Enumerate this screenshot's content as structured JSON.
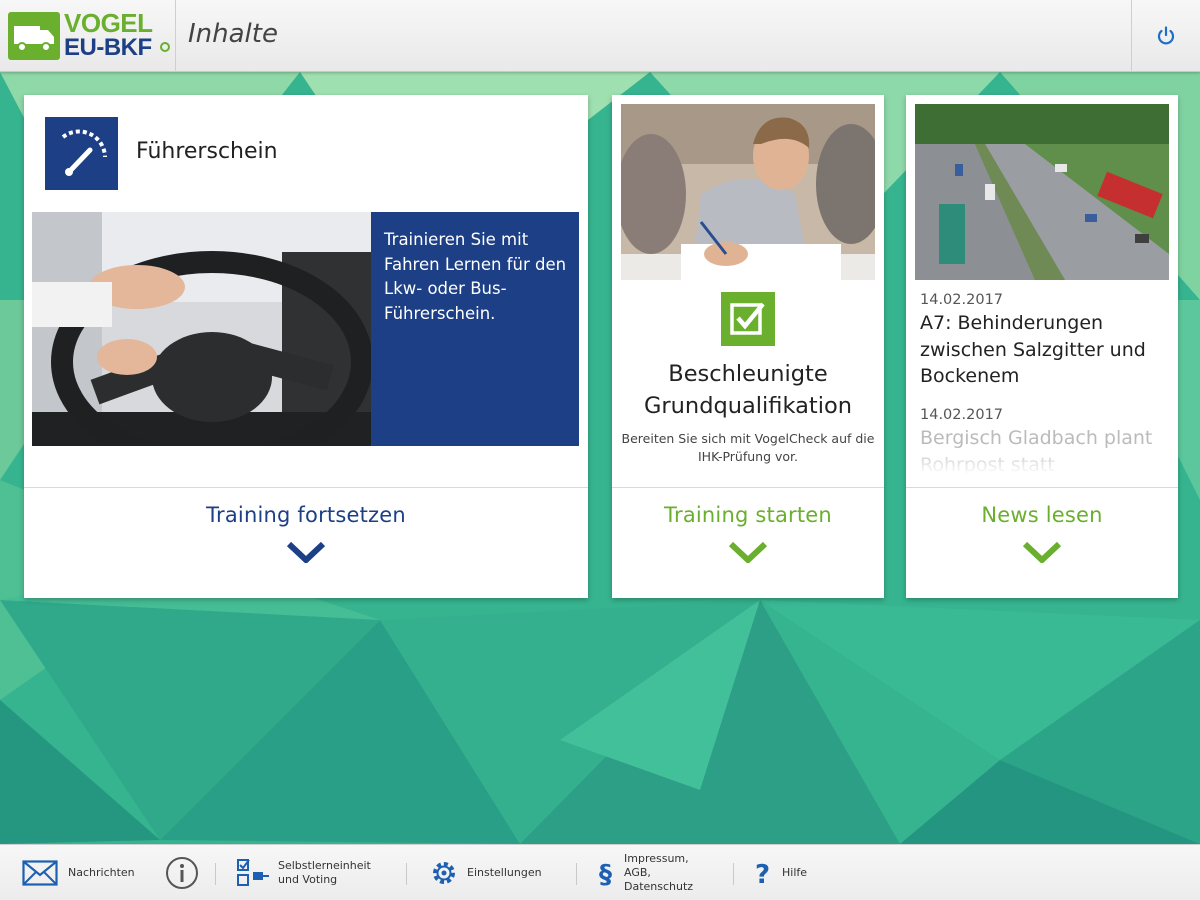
{
  "header": {
    "logo": {
      "line1": "VOGEL",
      "line2": "EU-BKF"
    },
    "title": "Inhalte",
    "power_icon": "power-icon"
  },
  "cards": {
    "fuehrerschein": {
      "title": "Führerschein",
      "icon": "speedometer-icon",
      "description": "Trainieren Sie mit Fahren Lernen für den Lkw- oder Bus-Führerschein.",
      "action": "Training fortsetzen"
    },
    "grundqualifikation": {
      "title": "Beschleunigte Grundqualifikation",
      "icon": "checkbox-icon",
      "description": "Bereiten Sie sich mit VogelCheck auf die IHK-Prüfung vor.",
      "action": "Training starten"
    },
    "news": {
      "items": [
        {
          "date": "14.02.2017",
          "headline": "A7: Behinderungen zwischen Salzgitter und Bockenem"
        },
        {
          "date": "14.02.2017",
          "headline": "Bergisch Gladbach plant Rohrpost statt"
        }
      ],
      "action": "News lesen"
    }
  },
  "footer": {
    "items": [
      {
        "label": "Nachrichten",
        "icon": "envelope-icon"
      },
      {
        "label": "",
        "icon": "info-icon"
      },
      {
        "label": "Selbstlerneinheit und Voting",
        "icon": "checklist-icon"
      },
      {
        "label": "Einstellungen",
        "icon": "gear-icon"
      },
      {
        "label": "Impressum, AGB, Datenschutz",
        "icon": "paragraph-icon"
      },
      {
        "label": "Hilfe",
        "icon": "question-icon"
      }
    ]
  },
  "colors": {
    "brand_blue": "#1d3f85",
    "brand_green": "#6aaf2d",
    "background_teal": "#3cb995"
  }
}
